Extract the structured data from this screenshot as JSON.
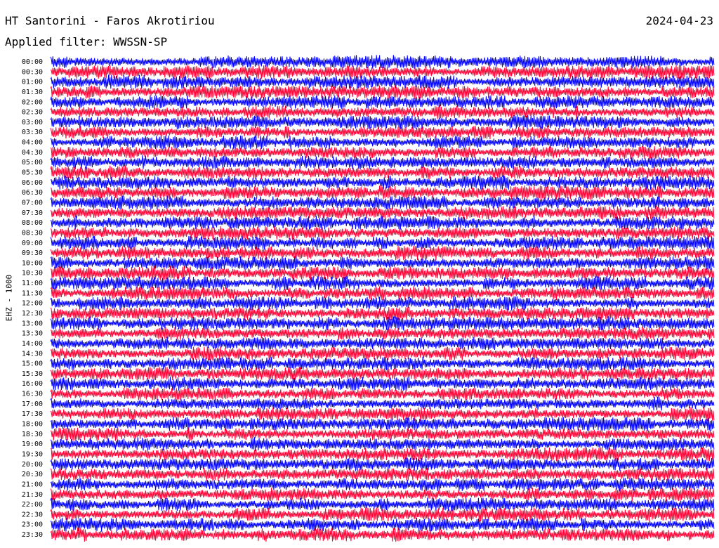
{
  "header": {
    "station": "HT Santorini - Faros Akrotiriou",
    "date": "2024-04-23",
    "filter": "Applied filter: WWSSN-SP"
  },
  "channel_label": "EHZ - 1000",
  "colors": {
    "trace_a": "#0000ff",
    "trace_b": "#ff0033",
    "background": "#ffffff",
    "text": "#000000"
  },
  "chart_data": {
    "type": "line",
    "subtype": "helicorder",
    "title": "HT Santorini - Faros Akrotiriou",
    "ylabel": "EHZ - 1000",
    "xlabel": "",
    "grid": false,
    "legend": "none",
    "row_labels": [
      "00:00",
      "00:30",
      "01:00",
      "01:30",
      "02:00",
      "02:30",
      "03:00",
      "03:30",
      "04:00",
      "04:30",
      "05:00",
      "05:30",
      "06:00",
      "06:30",
      "07:00",
      "07:30",
      "08:00",
      "08:30",
      "09:00",
      "09:30",
      "10:00",
      "10:30",
      "11:00",
      "11:30",
      "12:00",
      "12:30",
      "13:00",
      "13:30",
      "14:00",
      "14:30",
      "15:00",
      "15:30",
      "16:00",
      "16:30",
      "17:00",
      "17:30",
      "18:00",
      "18:30",
      "19:00",
      "19:30",
      "20:00",
      "20:30",
      "21:00",
      "21:30",
      "22:00",
      "22:30",
      "23:00",
      "23:30"
    ],
    "row_colors": [
      "trace_a",
      "trace_b"
    ]
  }
}
